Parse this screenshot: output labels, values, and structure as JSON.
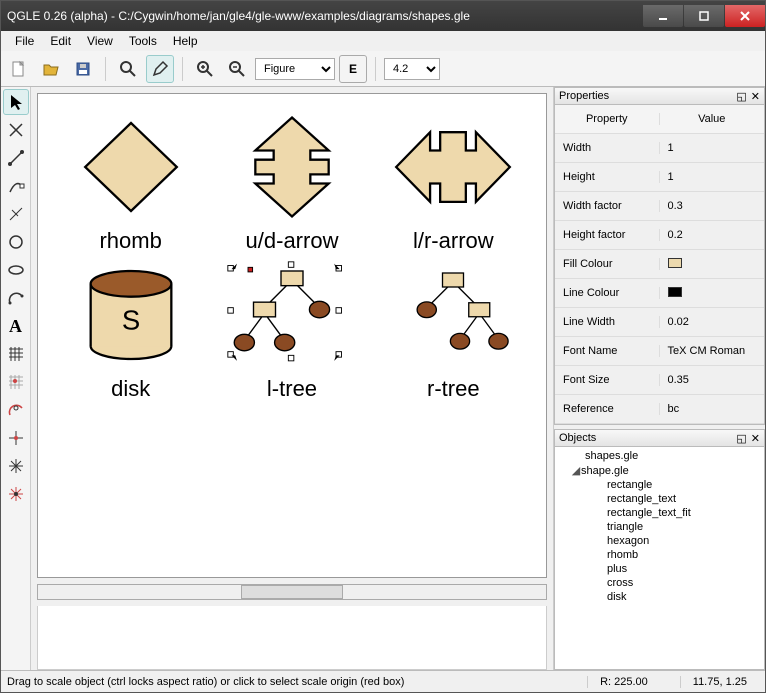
{
  "title": "QGLE 0.26 (alpha) - C:/Cygwin/home/jan/gle4/gle-www/examples/diagrams/shapes.gle",
  "menu": {
    "file": "File",
    "edit": "Edit",
    "view": "View",
    "tools": "Tools",
    "help": "Help"
  },
  "toolbar": {
    "figure_combo": "Figure",
    "zoom_combo": "4.2"
  },
  "shapes": {
    "rhomb": "rhomb",
    "ud_arrow": "u/d-arrow",
    "lr_arrow": "l/r-arrow",
    "disk": "disk",
    "disk_letter": "S",
    "ltree": "l-tree",
    "rtree": "r-tree"
  },
  "panels": {
    "properties_title": "Properties",
    "objects_title": "Objects",
    "prop_header_k": "Property",
    "prop_header_v": "Value"
  },
  "properties": [
    {
      "k": "Width",
      "v": "1"
    },
    {
      "k": "Height",
      "v": "1"
    },
    {
      "k": "Width factor",
      "v": "0.3"
    },
    {
      "k": "Height factor",
      "v": "0.2"
    },
    {
      "k": "Fill Colour",
      "v": "",
      "swatch": "#ecd9ae"
    },
    {
      "k": "Line Colour",
      "v": "",
      "swatch": "#000000"
    },
    {
      "k": "Line Width",
      "v": "0.02"
    },
    {
      "k": "Font Name",
      "v": "TeX CM Roman"
    },
    {
      "k": "Font Size",
      "v": "0.35"
    },
    {
      "k": "Reference",
      "v": "bc"
    }
  ],
  "objects": {
    "root": "shapes.gle",
    "expanded": "shape.gle",
    "items": [
      "rectangle",
      "rectangle_text",
      "rectangle_text_fit",
      "triangle",
      "hexagon",
      "rhomb",
      "plus",
      "cross",
      "disk"
    ]
  },
  "status": {
    "hint": "Drag to scale object (ctrl locks aspect ratio) or click to select scale origin (red box)",
    "r": "R:  225.00",
    "coord": "11.75, 1.25"
  },
  "colors": {
    "shape_fill": "#eed9ac",
    "shape_stroke": "#000",
    "brown": "#8a4a23"
  }
}
